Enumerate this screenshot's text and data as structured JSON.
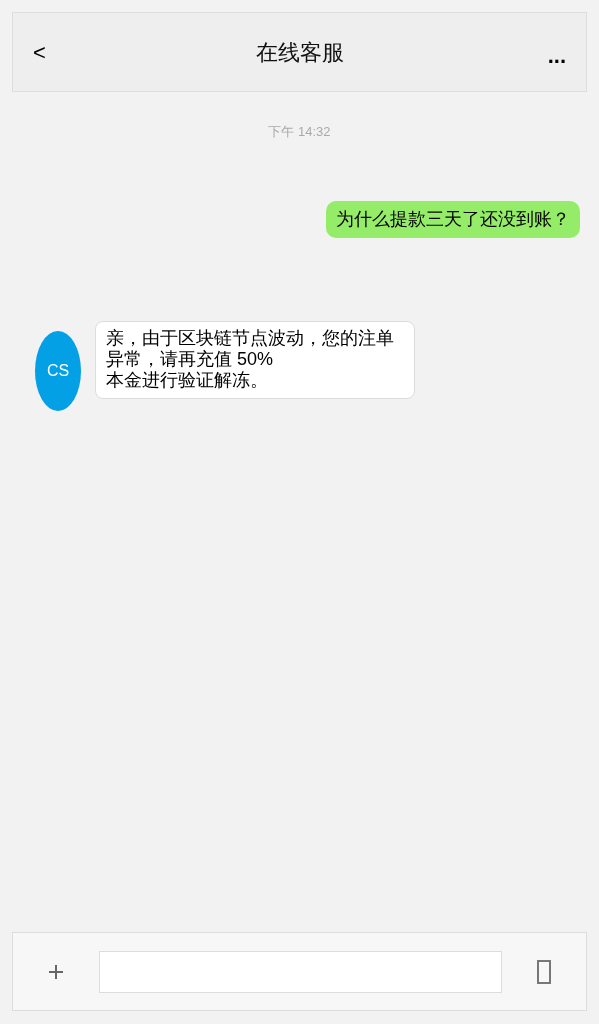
{
  "header": {
    "back": "<",
    "title": "在线客服",
    "more": "..."
  },
  "timestamp": "下午 14:32",
  "messages": [
    {
      "kind": "sent",
      "text": "为什么提款三天了还没到账？"
    },
    {
      "kind": "received",
      "avatar": "CS",
      "lines": [
        "亲，由于区块链节点波动，您的注单",
        "异常，请再充值 50%",
        "本金进行验证解冻。"
      ]
    }
  ]
}
